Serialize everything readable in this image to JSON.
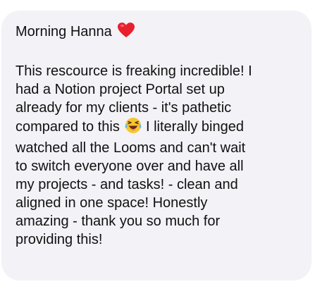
{
  "message": {
    "greeting": "Morning Hanna",
    "greeting_emoji": "red-heart",
    "lines": [
      "This rescource is freaking incredible! I",
      "had a Notion project Portal set up",
      "already for my clients - it's pathetic",
      "compared to this",
      "I literally binged",
      "watched all the Looms and can't wait",
      "to switch everyone over and have all",
      "my projects - and tasks! - clean and",
      "aligned in one space! Honestly",
      "amazing - thank you so much for",
      "providing this!"
    ],
    "inline_emoji": "face-with-tears-of-joy",
    "bubble_color": "#f2f2f7",
    "text_color": "#111111",
    "heart_color": "#e8202e",
    "laugh_face_color": "#f7c531"
  }
}
